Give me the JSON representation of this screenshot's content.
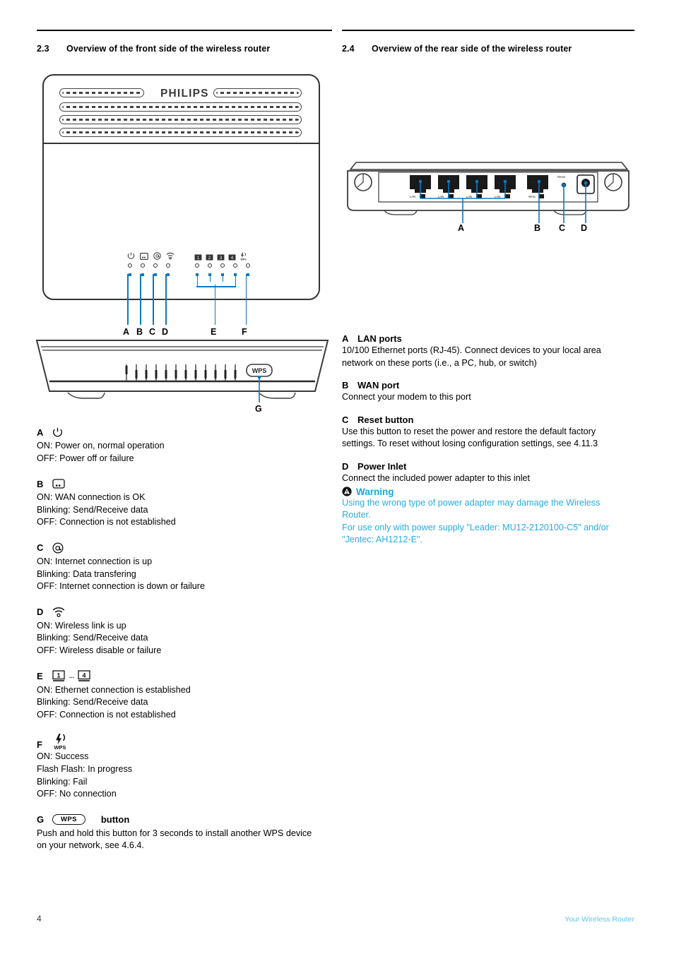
{
  "page": {
    "number": "4",
    "footer_right": "Your Wireless Router",
    "brand": "PHILIPS"
  },
  "sections": {
    "front": {
      "number": "2.3",
      "title": "Overview of the front side of the wireless router"
    },
    "rear": {
      "number": "2.4",
      "title": "Overview of the rear side of the wireless router"
    }
  },
  "front_figure": {
    "callout_labels": [
      "A",
      "B",
      "C",
      "D",
      "E",
      "F"
    ],
    "led_group_left": [
      "power-icon",
      "wan-icon",
      "at-icon",
      "wifi-icon"
    ],
    "led_group_right": [
      "lan1-icon",
      "lan2-icon",
      "lan3-icon",
      "lan4-icon",
      "wps-icon"
    ]
  },
  "top_figure": {
    "wps_button_label": "WPS",
    "callout_label": "G"
  },
  "rear_figure": {
    "port_labels": [
      "LAN",
      "LAN",
      "LAN",
      "LAN",
      "WAN"
    ],
    "reset_label": "Reset",
    "callout_labels": [
      "A",
      "B",
      "C",
      "D"
    ]
  },
  "led_legend": [
    {
      "letter": "A",
      "icon": "power-icon",
      "lines": [
        "ON: Power on, normal operation",
        "OFF: Power off or failure"
      ]
    },
    {
      "letter": "B",
      "icon": "wan-icon",
      "lines": [
        "ON: WAN connection is OK",
        "Blinking: Send/Receive data",
        "OFF: Connection is not established"
      ]
    },
    {
      "letter": "C",
      "icon": "at-icon",
      "lines": [
        "ON: Internet connection is up",
        "Blinking: Data transfering",
        "OFF: Internet connection is down or failure"
      ]
    },
    {
      "letter": "D",
      "icon": "wifi-icon",
      "lines": [
        "ON: Wireless link is up",
        "Blinking: Send/Receive data",
        "OFF: Wireless disable or failure"
      ]
    },
    {
      "letter": "E",
      "icon": "lan-range-icon",
      "icon_text": "1 ... 4",
      "lines": [
        "ON: Ethernet connection is established",
        "Blinking: Send/Receive data",
        "OFF: Connection is not established"
      ]
    },
    {
      "letter": "F",
      "icon": "wps-icon",
      "icon_text": "WPS",
      "lines": [
        "ON: Success",
        "Flash Flash: In progress",
        "Blinking: Fail",
        "OFF: No connection"
      ]
    }
  ],
  "wps_button_item": {
    "letter": "G",
    "button_label": "WPS",
    "suffix": "button",
    "lines": [
      "Push and hold this button for 3 seconds to install another WPS device",
      "on your network, see 4.6.4."
    ]
  },
  "rear_legend": [
    {
      "letter": "A",
      "title": "LAN ports",
      "lines": [
        "10/100 Ethernet ports (RJ-45). Connect devices to your local area",
        "network on these ports (i.e., a PC, hub, or switch)"
      ]
    },
    {
      "letter": "B",
      "title": "WAN port",
      "lines": [
        "Connect your modem to this port"
      ]
    },
    {
      "letter": "C",
      "title": "Reset button",
      "lines": [
        "Use this button to reset the power and restore the default factory",
        "settings. To reset without losing configuration settings, see 4.11.3"
      ]
    },
    {
      "letter": "D",
      "title": "Power Inlet",
      "lines": [
        "Connect the included power adapter to this inlet"
      ]
    }
  ],
  "warning": {
    "label": "Warning",
    "lines": [
      "Using the wrong type of power adapter may damage the Wireless",
      "Router.",
      "For use only with power supply \"Leader: MU12-2120100-C5\" and/or",
      "\"Jentec: AH1212-E\"."
    ]
  },
  "colors": {
    "callout_blue": "#0B78C2",
    "warning_blue": "#29ABE2",
    "footer_blue": "#5BC5F2"
  }
}
